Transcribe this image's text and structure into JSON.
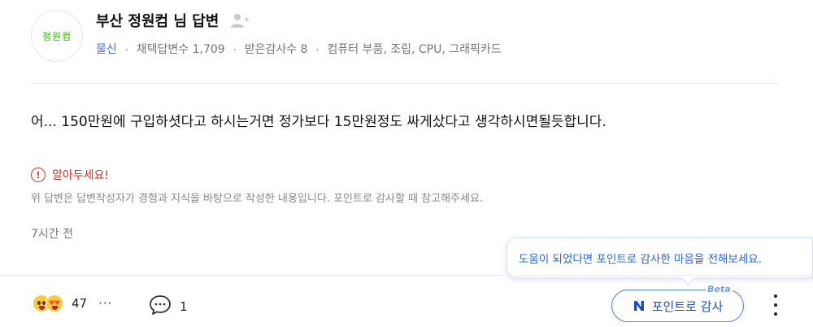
{
  "profile": {
    "avatar_text": "정원컴",
    "name": "부산 정원컴 님 답변",
    "grade": "물신",
    "meta_dot": "・",
    "adopted_label": "채택답변수 1,709",
    "thanks_label": "받은감사수 8",
    "category": "컴퓨터 부품, 조립, CPU, 그래픽카드"
  },
  "answer": {
    "text": "어... 150만원에 구입하셧다고 하시는거면 정가보다 15만원정도 싸게샀다고 생각하시면될듯합니다."
  },
  "notice": {
    "icon": "!",
    "title": "알아두세요!",
    "text": "위 답변은 답변작성자가 경험과 지식을 바탕으로 작성한 내용입니다. 포인트로 감사할 때 참고해주세요."
  },
  "time": "7시간 전",
  "tooltip": "도움이 되었다면 포인트로 감사한 마음을 전해보세요.",
  "actions": {
    "reaction_count": "47",
    "more_label": "···",
    "comment_count": "1",
    "thanks_button_label": "포인트로 감사",
    "thanks_button_icon_text": "N",
    "beta_label": "Beta"
  },
  "colors": {
    "accent": "#4c82e6",
    "grade": "#3b6bd6",
    "warning": "#cc2a2a",
    "avatar_text": "#2db400"
  },
  "icons": {
    "follow": "add-person-icon",
    "warning": "warning-circle-icon",
    "comment": "speech-bubble-icon",
    "point": "n-point-icon",
    "more": "vertical-dots-icon"
  }
}
